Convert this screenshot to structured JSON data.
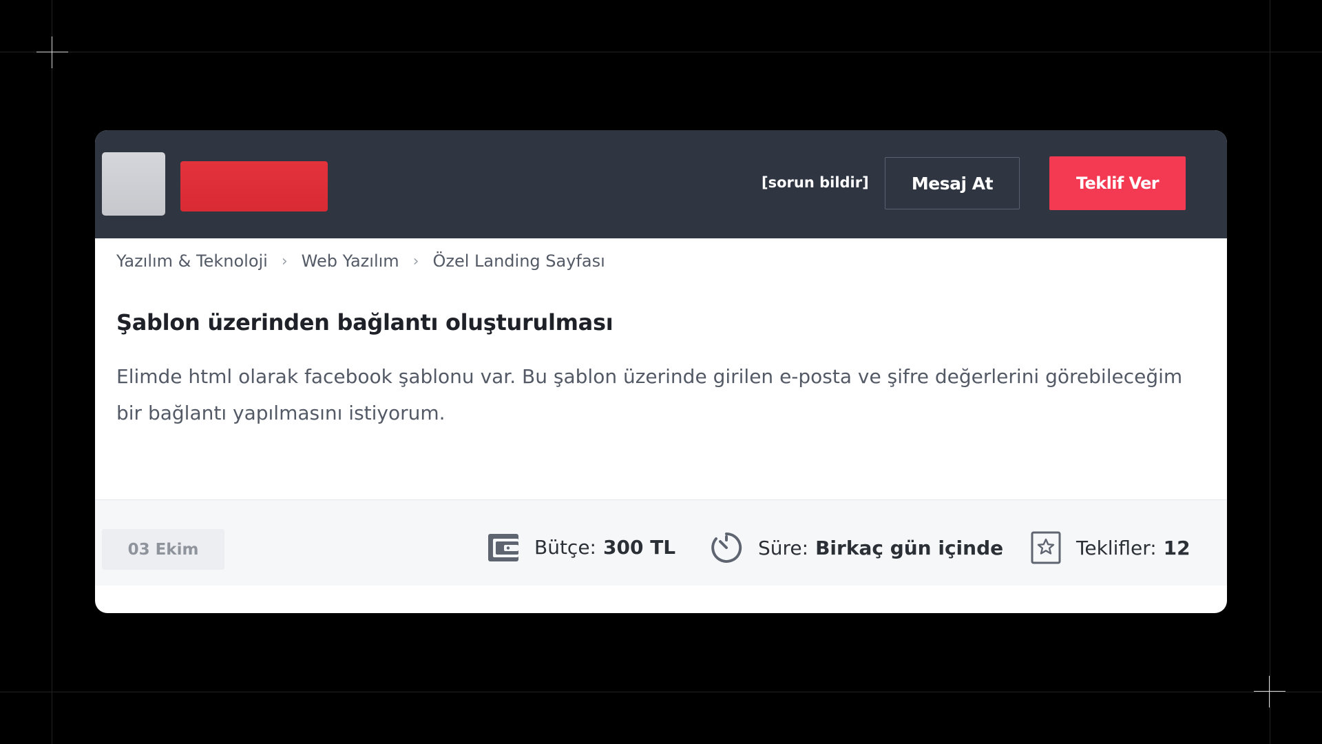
{
  "header": {
    "report_link": "[sorun bildir]",
    "message_button": "Mesaj At",
    "offer_button": "Teklif Ver"
  },
  "breadcrumb": {
    "items": [
      "Yazılım & Teknoloji",
      "Web Yazılım",
      "Özel Landing Sayfası"
    ],
    "separator": "›"
  },
  "job": {
    "title": "Şablon üzerinden bağlantı oluşturulması",
    "description": "Elimde html olarak facebook şablonu var. Bu şablon üzerinde girilen e-posta ve şifre değerlerini görebileceğim bir bağlantı yapılmasını istiyorum."
  },
  "footer": {
    "date": "03 Ekim",
    "budget": {
      "label": "Bütçe:",
      "value": "300 TL",
      "icon": "wallet-icon"
    },
    "duration": {
      "label": "Süre:",
      "value": "Birkaç gün içinde",
      "icon": "timer-icon"
    },
    "offers": {
      "label": "Teklifler:",
      "value": "12",
      "icon": "star-box-icon"
    }
  },
  "colors": {
    "page_background": "#000000",
    "header_background": "#2f3541",
    "accent_red": "#f43a53",
    "brand_red": "#e3323b",
    "card_background": "#ffffff",
    "footer_background": "#f6f7f9"
  }
}
